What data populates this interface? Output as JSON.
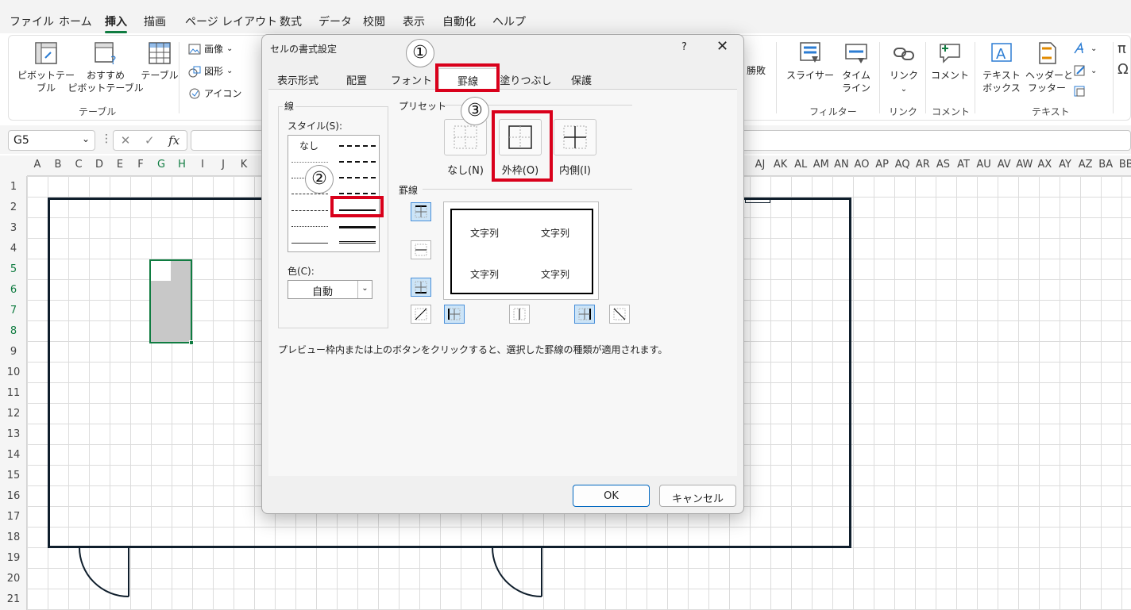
{
  "menu_tabs": [
    "ファイル",
    "ホーム",
    "挿入",
    "描画",
    "ページ レイアウト",
    "数式",
    "データ",
    "校閲",
    "表示",
    "自動化",
    "ヘルプ"
  ],
  "active_menu_tab": "挿入",
  "ribbon": {
    "pivot_table": "ピボットテー\nブル",
    "pivot_table_arrow": "⌄",
    "recommended_pivot": "おすすめ\nピボットテーブル",
    "table": "テーブル",
    "group_table": "テーブル",
    "image": "画像",
    "shape": "図形",
    "icon": "アイコン",
    "winloss": "勝敗",
    "slicer": "スライサー",
    "timeline": "タイム\nライン",
    "group_filter": "フィルター",
    "link": "リンク",
    "group_link": "リンク",
    "comment": "コメント",
    "group_comment": "コメント",
    "textbox": "テキスト\nボックス",
    "header_footer": "ヘッダーと\nフッター",
    "group_text": "テキスト"
  },
  "formula_bar": {
    "name_box": "G5",
    "fx": "fx"
  },
  "columns": [
    "A",
    "B",
    "C",
    "D",
    "E",
    "F",
    "G",
    "H",
    "I",
    "J",
    "K",
    "AJ",
    "AK",
    "AL",
    "AM",
    "AN",
    "AO",
    "AP",
    "AQ",
    "AR",
    "AS",
    "AT",
    "AU",
    "AV",
    "AW",
    "AX",
    "AY",
    "AZ",
    "BA",
    "BB"
  ],
  "rows": [
    "1",
    "2",
    "3",
    "4",
    "5",
    "6",
    "7",
    "8",
    "9",
    "10",
    "11",
    "12",
    "13",
    "14",
    "15",
    "16",
    "17",
    "18",
    "19",
    "20",
    "21"
  ],
  "dialog": {
    "title": "セルの書式設定",
    "help": "?",
    "close": "✕",
    "tabs": [
      "表示形式",
      "配置",
      "フォント",
      "罫線",
      "塗りつぶし",
      "保護"
    ],
    "active_tab": "罫線",
    "line_group": "線",
    "style_label": "スタイル(S):",
    "none_style": "なし",
    "color_label": "色(C):",
    "color_value": "自動",
    "preset_group": "プリセット",
    "preset_none": "なし(N)",
    "preset_outline": "外枠(O)",
    "preset_inside": "内側(I)",
    "border_group": "罫線",
    "preview_text": "文字列",
    "info": "プレビュー枠内または上のボタンをクリックすると、選択した罫線の種類が適用されます。",
    "ok": "OK",
    "cancel": "キャンセル"
  },
  "annotations": [
    "①",
    "②",
    "③"
  ],
  "colors": {
    "accent": "#107c41",
    "highlight": "#d9001b",
    "selected_btn": "#cce4f7"
  }
}
